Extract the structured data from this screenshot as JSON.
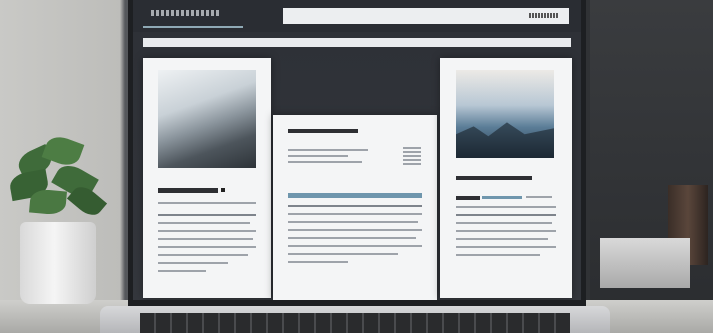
{
  "scene": {
    "description_items": [
      "laptop",
      "plant",
      "keyboard",
      "shelf"
    ]
  },
  "screen": {
    "nav_text": "",
    "cards": [
      {
        "heading": "",
        "body": ""
      },
      {
        "heading": "",
        "body": ""
      },
      {
        "heading": "",
        "sub_heading": "",
        "body": ""
      }
    ]
  },
  "colors": {
    "accent": "#6f96ad",
    "screen_bg": "#2d3036",
    "plant_leaf": "#3f6b3a"
  }
}
